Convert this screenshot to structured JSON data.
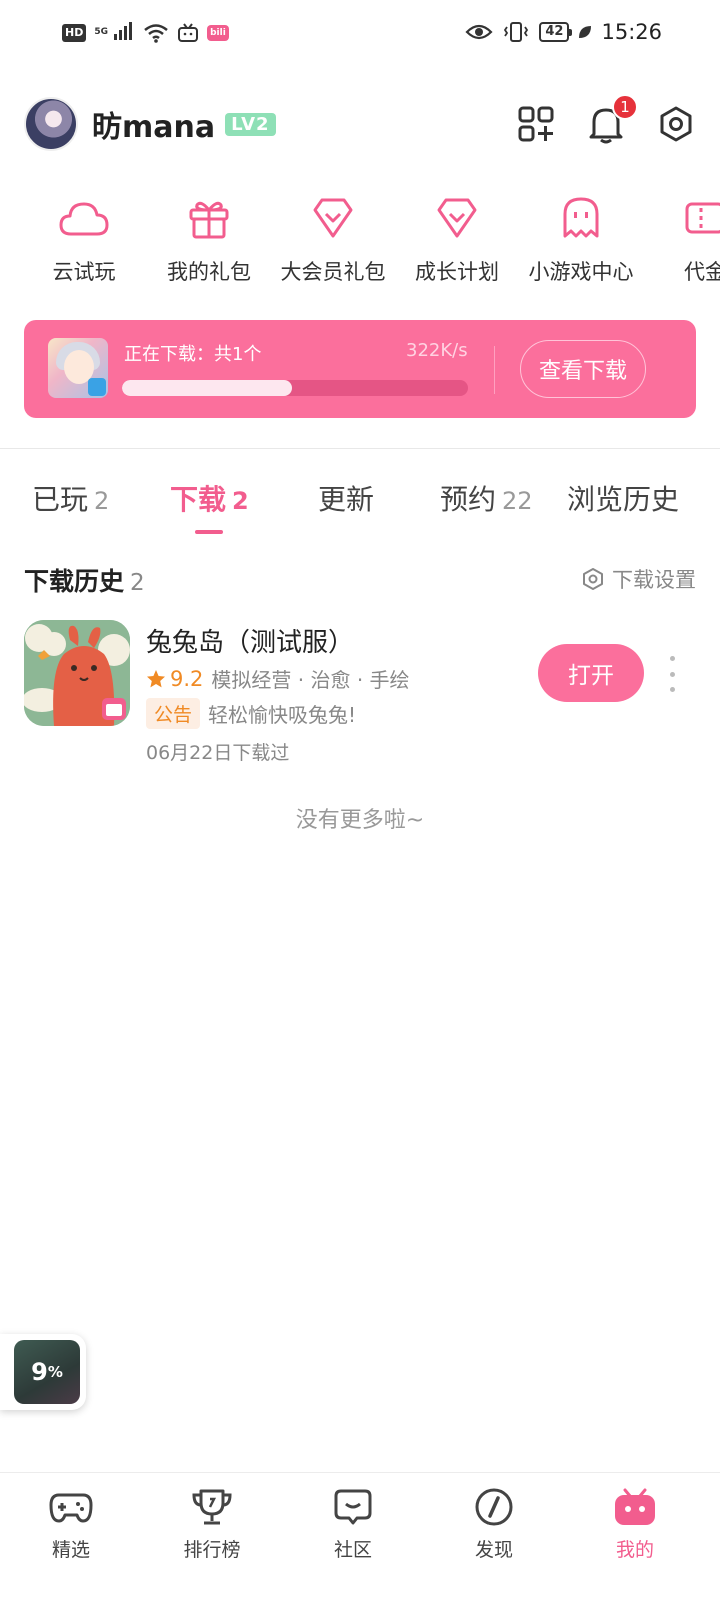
{
  "status_bar": {
    "hd": "HD",
    "network": "5G",
    "bili_badge": "bili",
    "battery": "42",
    "time": "15:26"
  },
  "profile": {
    "username": "昉mana",
    "level": "LV2",
    "notification_count": "1"
  },
  "quick_entries": [
    {
      "label": "云试玩",
      "icon": "cloud-icon"
    },
    {
      "label": "我的礼包",
      "icon": "gift-icon"
    },
    {
      "label": "大会员礼包",
      "icon": "vip-gift-icon"
    },
    {
      "label": "成长计划",
      "icon": "growth-icon"
    },
    {
      "label": "小游戏中心",
      "icon": "ghost-icon"
    },
    {
      "label": "代金",
      "icon": "voucher-icon"
    }
  ],
  "download_banner": {
    "status": "正在下载：共1个",
    "speed": "322K/s",
    "progress": 0.49,
    "view_button": "查看下载"
  },
  "tabs": [
    {
      "label": "已玩",
      "count": "2",
      "active": false
    },
    {
      "label": "下载",
      "count": "2",
      "active": true
    },
    {
      "label": "更新",
      "count": "",
      "active": false
    },
    {
      "label": "预约",
      "count": "22",
      "active": false
    },
    {
      "label": "浏览历史",
      "count": "",
      "active": false
    }
  ],
  "history": {
    "title": "下载历史",
    "count": "2",
    "settings_label": "下载设置"
  },
  "game": {
    "name": "兔兔岛（测试服）",
    "rating": "9.2",
    "tags": "模拟经营 · 治愈 · 手绘",
    "notice_tag": "公告",
    "notice_text": "轻松愉快吸兔兔!",
    "download_date": "06月22日下载过",
    "open_button": "打开"
  },
  "list_end": "没有更多啦~",
  "float_widget": {
    "percent": "9",
    "percent_sign": "%"
  },
  "bottom_nav": [
    {
      "label": "精选",
      "icon": "gamepad-icon",
      "active": false
    },
    {
      "label": "排行榜",
      "icon": "trophy-icon",
      "active": false
    },
    {
      "label": "社区",
      "icon": "community-icon",
      "active": false
    },
    {
      "label": "发现",
      "icon": "compass-icon",
      "active": false
    },
    {
      "label": "我的",
      "icon": "mine-icon",
      "active": true
    }
  ],
  "colors": {
    "accent": "#f25d8e",
    "banner": "#fb6f9c",
    "rating": "#f08a24"
  }
}
